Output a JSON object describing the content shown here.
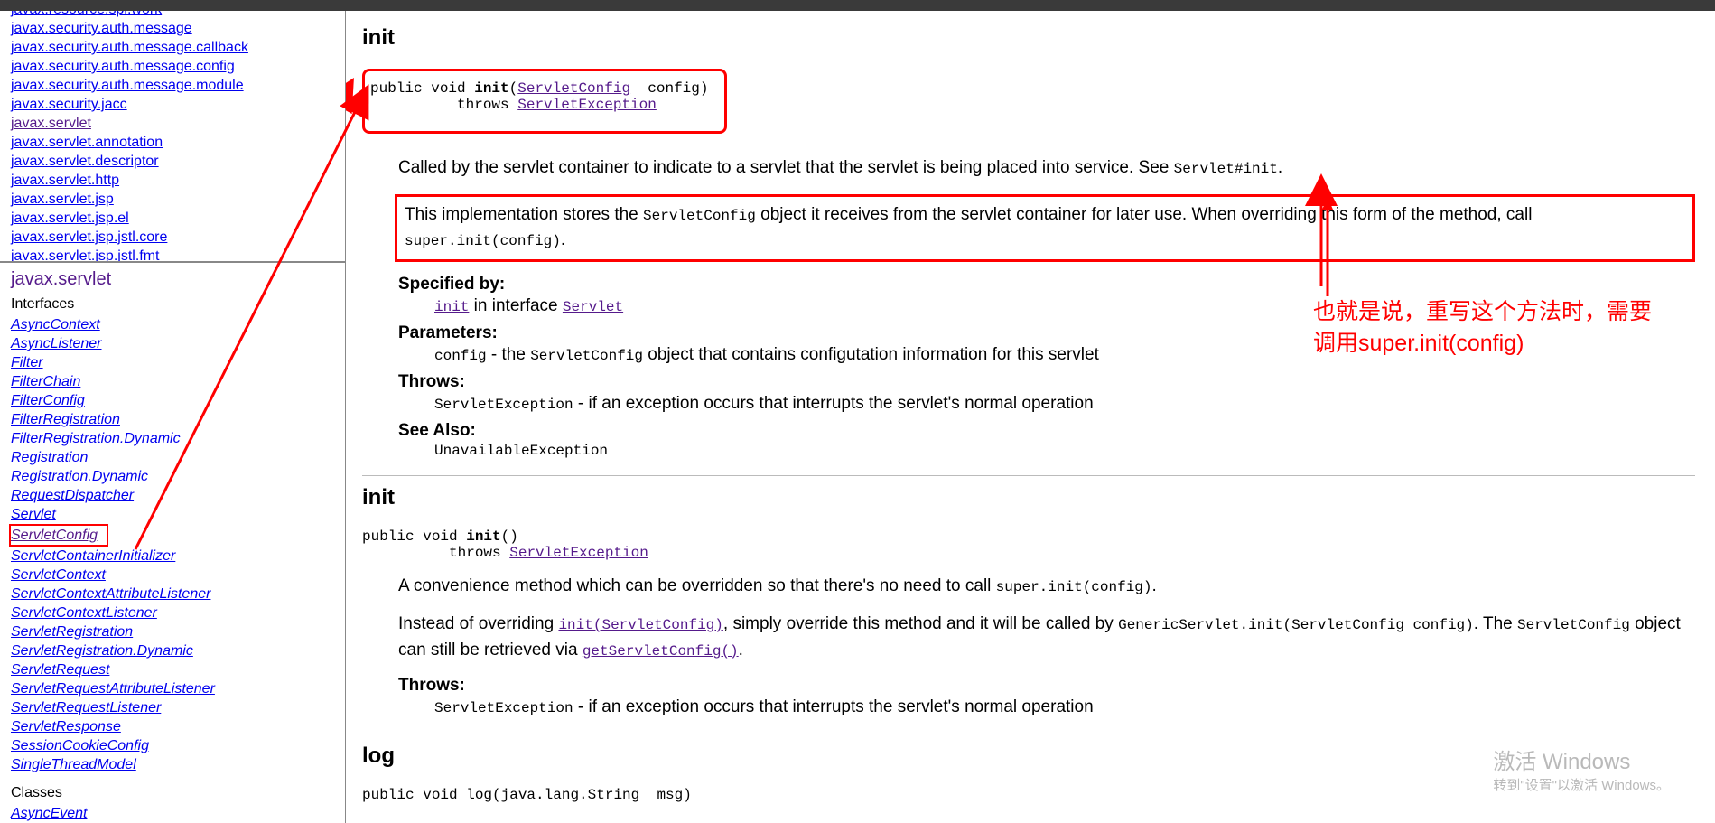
{
  "topbar_color": "#3a3a3a",
  "packages": [
    "javax.resource.spi.work",
    "javax.security.auth.message",
    "javax.security.auth.message.callback",
    "javax.security.auth.message.config",
    "javax.security.auth.message.module",
    "javax.security.jacc",
    "javax.servlet",
    "javax.servlet.annotation",
    "javax.servlet.descriptor",
    "javax.servlet.http",
    "javax.servlet.jsp",
    "javax.servlet.jsp.el",
    "javax.servlet.jsp.jstl.core",
    "javax.servlet.jsp.jstl.fmt"
  ],
  "package_title": "javax.servlet",
  "interfaces_label": "Interfaces",
  "interfaces": [
    "AsyncContext",
    "AsyncListener",
    "Filter",
    "FilterChain",
    "FilterConfig",
    "FilterRegistration",
    "FilterRegistration.Dynamic",
    "Registration",
    "Registration.Dynamic",
    "RequestDispatcher",
    "Servlet",
    "ServletConfig",
    "ServletContainerInitializer",
    "ServletContext",
    "ServletContextAttributeListener",
    "ServletContextListener",
    "ServletRegistration",
    "ServletRegistration.Dynamic",
    "ServletRequest",
    "ServletRequestAttributeListener",
    "ServletRequestListener",
    "ServletResponse",
    "SessionCookieConfig",
    "SingleThreadModel"
  ],
  "selected_interface": "ServletConfig",
  "classes_label": "Classes",
  "classes": [
    "AsyncEvent"
  ],
  "method1": {
    "title": "init",
    "sig_pre": "public void ",
    "sig_name": "init",
    "sig_open": "(",
    "sig_type": "ServletConfig",
    "sig_paren": "  config)",
    "sig_throws_indent": "          throws ",
    "sig_exc": "ServletException",
    "desc1_a": "Called by the servlet container to indicate to a servlet that the servlet is being placed into service. See ",
    "desc1_code": "Servlet#init",
    "desc1_b": ".",
    "desc2_a": "This implementation stores the ",
    "desc2_code1": "ServletConfig",
    "desc2_b": " object it receives from the servlet container for later use. When overriding this form of the method, call ",
    "desc2_code2": "super.init(config)",
    "desc2_c": ".",
    "spec_label": "Specified by:",
    "spec_link": "init",
    "spec_mid": " in interface ",
    "spec_iface": "Servlet",
    "params_label": "Parameters:",
    "param_name": "config",
    "param_dash": " - the ",
    "param_type": "ServletConfig",
    "param_rest": " object that contains configutation information for this servlet",
    "throws_label": "Throws:",
    "throw_type": "ServletException",
    "throw_rest": " - if an exception occurs that interrupts the servlet's normal operation",
    "seealso_label": "See Also:",
    "seealso_val": "UnavailableException"
  },
  "method2": {
    "title": "init",
    "sig_pre": "public void ",
    "sig_name": "init",
    "sig_paren": "()",
    "sig_throws_indent": "          throws ",
    "sig_exc": "ServletException",
    "desc1_a": "A convenience method which can be overridden so that there's no need to call ",
    "desc1_code": "super.init(config)",
    "desc1_b": ".",
    "desc2_a": "Instead of overriding ",
    "desc2_link1": "init(ServletConfig)",
    "desc2_b": ", simply override this method and it will be called by ",
    "desc2_code1": "GenericServlet.init(ServletConfig config)",
    "desc2_c": ". The ",
    "desc2_code2": "ServletConfig",
    "desc2_d": " object can still be retrieved via ",
    "desc2_link2": "getServletConfig()",
    "desc2_e": ".",
    "throws_label": "Throws:",
    "throw_type": "ServletException",
    "throw_rest": " - if an exception occurs that interrupts the servlet's normal operation"
  },
  "method3": {
    "title": "log",
    "sig": "public void log(java.lang.String  msg)"
  },
  "annotation": {
    "line1": "也就是说，重写这个方法时，需要",
    "line2": "调用super.init(config)"
  },
  "watermark": {
    "line1": "激活 Windows",
    "line2": "转到\"设置\"以激活 Windows。"
  }
}
